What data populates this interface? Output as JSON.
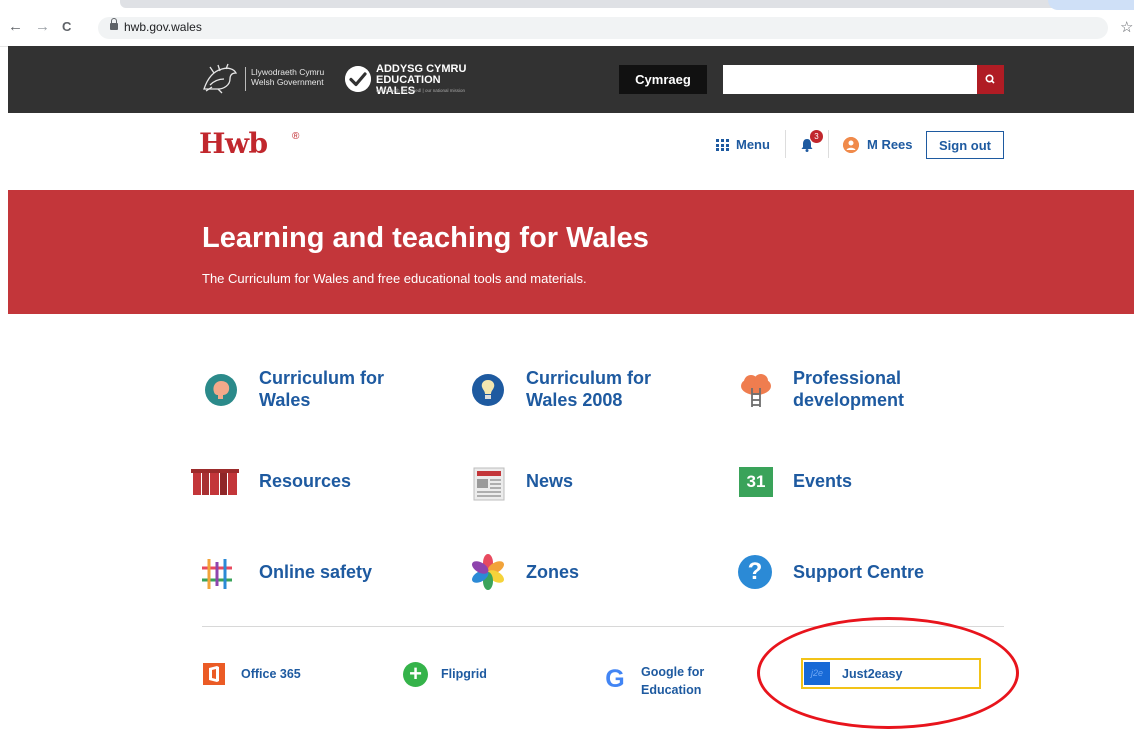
{
  "browser": {
    "url": "hwb.gov.wales",
    "back_glyph": "←",
    "forward_glyph": "→",
    "reload_glyph": "C",
    "star_glyph": "☆"
  },
  "gov_bar": {
    "welsh_gov_line1": "Llywodraeth Cymru",
    "welsh_gov_line2": "Welsh Government",
    "education_line1": "ADDYSG CYMRU",
    "education_line2": "EDUCATION WALES",
    "education_tagline": "cenhadaeth ein cenedl | our national mission",
    "language_button": "Cymraeg",
    "search_placeholder": ""
  },
  "header": {
    "logo": "Hwb",
    "logo_mark": "®",
    "menu_label": "Menu",
    "notification_count": "3",
    "user_name": "M Rees",
    "sign_out_label": "Sign out"
  },
  "hero": {
    "title": "Learning and teaching for Wales",
    "subtitle": "The Curriculum for Wales and free educational tools and materials."
  },
  "tiles": [
    {
      "line1": "Curriculum for",
      "line2": "Wales",
      "icon": "brain-icon"
    },
    {
      "line1": "Curriculum for",
      "line2": "Wales 2008",
      "icon": "lightbulb-icon"
    },
    {
      "line1": "Professional",
      "line2": "development",
      "icon": "cloud-ladder-icon"
    },
    {
      "line1": "Resources",
      "line2": "",
      "icon": "books-icon"
    },
    {
      "line1": "News",
      "line2": "",
      "icon": "newspaper-icon"
    },
    {
      "line1": "Events",
      "line2": "",
      "icon": "calendar-icon",
      "icon_text": "31"
    },
    {
      "line1": "Online safety",
      "line2": "",
      "icon": "online-safety-icon"
    },
    {
      "line1": "Zones",
      "line2": "",
      "icon": "zones-flower-icon"
    },
    {
      "line1": "Support Centre",
      "line2": "",
      "icon": "question-icon",
      "icon_text": "?"
    }
  ],
  "tools": [
    {
      "line1": "Office 365",
      "line2": "",
      "icon": "office365-icon"
    },
    {
      "line1": "Flipgrid",
      "line2": "",
      "icon": "flipgrid-icon",
      "icon_text": "+"
    },
    {
      "line1": "Google for",
      "line2": "Education",
      "icon": "google-icon",
      "icon_text": "G"
    },
    {
      "line1": "Just2easy",
      "line2": "",
      "icon": "just2easy-icon",
      "icon_text": "j2e"
    }
  ],
  "colors": {
    "brand_red": "#c3363a",
    "link_blue": "#1e5aa0",
    "gov_bar": "#323232",
    "highlight_yellow": "#f2c318",
    "annotation_red": "#e8141c"
  }
}
